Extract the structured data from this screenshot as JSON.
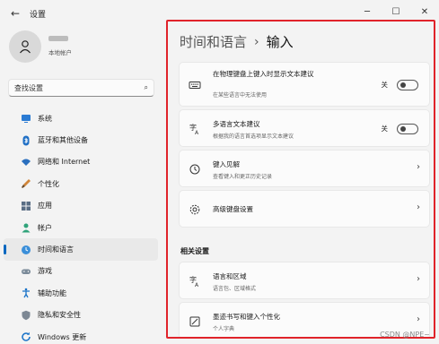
{
  "window": {
    "title": "设置",
    "back_icon": "arrow-left-icon",
    "minimize": "─",
    "maximize": "☐",
    "close": "✕"
  },
  "profile": {
    "account_type": "本地帐户"
  },
  "search": {
    "placeholder": "查找设置",
    "icon": "⌕"
  },
  "sidebar": {
    "items": [
      {
        "label": "系统",
        "icon": "monitor-icon"
      },
      {
        "label": "蓝牙和其他设备",
        "icon": "bluetooth-icon"
      },
      {
        "label": "网络和 Internet",
        "icon": "wifi-icon"
      },
      {
        "label": "个性化",
        "icon": "brush-icon"
      },
      {
        "label": "应用",
        "icon": "apps-icon"
      },
      {
        "label": "帐户",
        "icon": "person-icon"
      },
      {
        "label": "时间和语言",
        "icon": "globe-clock-icon",
        "selected": true
      },
      {
        "label": "游戏",
        "icon": "gamepad-icon"
      },
      {
        "label": "辅助功能",
        "icon": "accessibility-icon"
      },
      {
        "label": "隐私和安全性",
        "icon": "shield-icon"
      },
      {
        "label": "Windows 更新",
        "icon": "update-icon"
      }
    ]
  },
  "main": {
    "breadcrumb_parent": "时间和语言",
    "breadcrumb_sep": "›",
    "breadcrumb_current": "输入",
    "cards": [
      {
        "title": "在物理键盘上键入时显示文本建议",
        "desc": "在某些语言中无法使用",
        "toggle_label": "关",
        "toggle_on": false,
        "icon": "keyboard-icon"
      },
      {
        "title": "多语言文本建议",
        "desc": "根据我的语言首选项显示文本建议",
        "toggle_label": "关",
        "toggle_on": false,
        "icon": "language-icon"
      },
      {
        "title": "键入见解",
        "desc": "查看键入和更正历史记录",
        "icon": "history-icon"
      },
      {
        "title": "高级键盘设置",
        "desc": "",
        "icon": "gear-icon"
      }
    ],
    "related_title": "相关设置",
    "related_cards": [
      {
        "title": "语言和区域",
        "desc": "语言包、区域格式",
        "icon": "language-region-icon"
      },
      {
        "title": "墨迹书写和键入个性化",
        "desc": "个人字典",
        "icon": "ink-icon"
      }
    ],
    "chevron": "›"
  },
  "watermark": "CSDN @NPE~",
  "colors": {
    "accent": "#0067c0",
    "highlight_border": "#e0232a",
    "background": "#f3f3f3",
    "card": "#fbfbfb"
  }
}
